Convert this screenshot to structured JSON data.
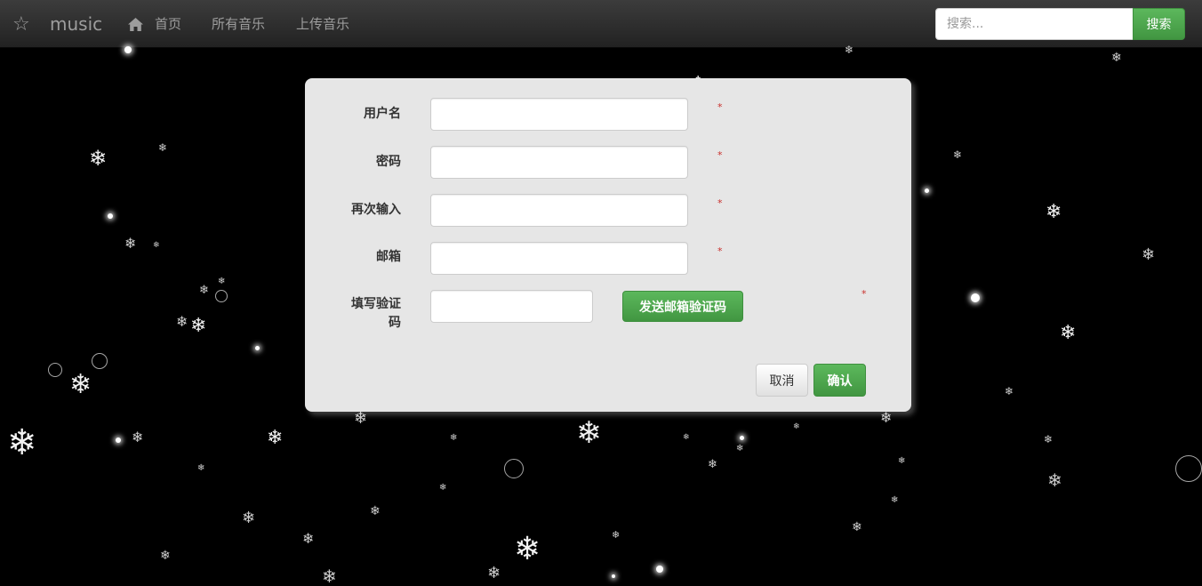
{
  "navbar": {
    "brand_icon": "star-icon",
    "brand": "music",
    "links": [
      {
        "label": "首页",
        "icon": "home-icon"
      },
      {
        "label": "所有音乐"
      },
      {
        "label": "上传音乐"
      }
    ],
    "search": {
      "placeholder": "搜索...",
      "value": "",
      "button": "搜索"
    }
  },
  "form": {
    "fields": [
      {
        "label": "用户名",
        "value": "",
        "required": "*"
      },
      {
        "label": "密码",
        "value": "",
        "required": "*"
      },
      {
        "label": "再次输入",
        "value": "",
        "required": "*"
      },
      {
        "label": "邮箱",
        "value": "",
        "required": "*"
      }
    ],
    "captcha": {
      "label": "填写验证码",
      "value": "",
      "required": "*",
      "send_button": "发送邮箱验证码"
    },
    "cancel": "取消",
    "confirm": "确认"
  },
  "colors": {
    "accent": "#5cb85c",
    "navbar": "#2d2d2d",
    "background": "#000000",
    "panel": "#e6e6e6"
  }
}
